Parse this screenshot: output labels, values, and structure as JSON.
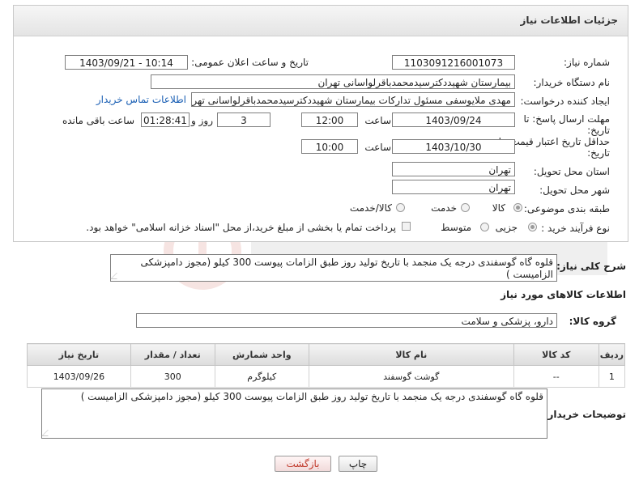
{
  "header": {
    "title": "جزئیات اطلاعات نیاز"
  },
  "fields": {
    "need_number_label": "شماره نیاز:",
    "need_number": "1103091216001073",
    "announce_label": "تاریخ و ساعت اعلان عمومی:",
    "announce_value": "1403/09/21 - 10:14",
    "buyer_org_label": "نام دستگاه خریدار:",
    "buyer_org": "بیمارستان شهیددکترسیدمحمدباقرلواسانی تهران",
    "creator_label": "ایجاد کننده درخواست:",
    "creator": "مهدی ملایوسفی مسئول تدارکات بیمارستان شهیددکترسیدمحمدباقرلواسانی تهران",
    "contact_link": "اطلاعات تماس خریدار",
    "deadline_label_1": "مهلت ارسال پاسخ: تا",
    "deadline_label_2": "تاریخ:",
    "deadline_date": "1403/09/24",
    "deadline_time_label": "ساعت",
    "deadline_time": "12:00",
    "days_value": "3",
    "days_label": "روز و",
    "remaining_time": "01:28:41",
    "remaining_label": "ساعت باقی مانده",
    "validity_label_1": "حداقل تاریخ اعتبار قیمت: تا",
    "validity_label_2": "تاریخ:",
    "validity_date": "1403/10/30",
    "validity_time_label": "ساعت",
    "validity_time": "10:00",
    "province_label": "استان محل تحویل:",
    "province": "تهران",
    "city_label": "شهر محل تحویل:",
    "city": "تهران",
    "category_label": "طبقه بندی موضوعی:",
    "category_options": [
      "کالا",
      "خدمت",
      "کالا/خدمت"
    ],
    "process_label": "نوع فرآیند خرید :",
    "process_options": [
      "جزیی",
      "متوسط"
    ],
    "payment_note": "پرداخت تمام یا بخشی از مبلغ خرید،از محل \"اسناد خزانه اسلامی\" خواهد بود."
  },
  "description": {
    "label": "شرح کلی نیاز:",
    "text": "قلوه گاه گوسفندی درجه یک منجمد با تاریخ تولید روز طبق الزامات پیوست 300 کیلو (مجوز دامپزشکی الزامیست )"
  },
  "goods": {
    "section_title": "اطلاعات کالاهای مورد نیاز",
    "group_label": "گروه کالا:",
    "group_value": "دارو، پزشکی و سلامت",
    "columns": [
      "ردیف",
      "کد کالا",
      "نام کالا",
      "واحد شمارش",
      "تعداد / مقدار",
      "تاریخ نیاز"
    ],
    "rows": [
      [
        "1",
        "--",
        "گوشت گوسفند",
        "کیلوگرم",
        "300",
        "1403/09/26"
      ]
    ]
  },
  "buyer_notes": {
    "label": "توضیحات خریدار:",
    "text": "قلوه گاه گوسفندی درجه یک منجمد با تاریخ تولید روز طبق الزامات پیوست 300 کیلو (مجوز دامپزشکی الزامیست )"
  },
  "buttons": {
    "print": "چاپ",
    "back": "بازگشت"
  },
  "colors": {
    "link": "#1a5fb4",
    "back_text": "#c0392b"
  }
}
